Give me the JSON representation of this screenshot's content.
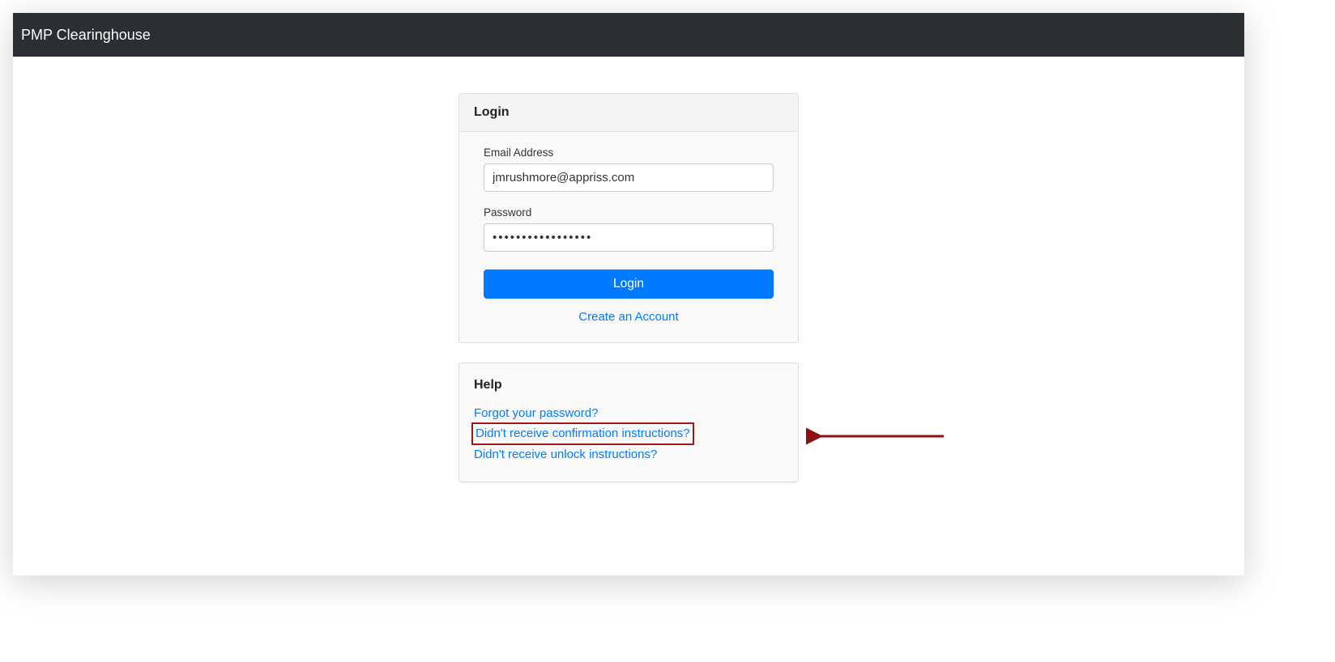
{
  "navbar": {
    "title": "PMP Clearinghouse"
  },
  "login_card": {
    "header": "Login",
    "email_label": "Email Address",
    "email_value": "jmrushmore@appriss.com",
    "password_label": "Password",
    "password_value": "•••••••••••••••••",
    "login_button": "Login",
    "create_account": "Create an Account"
  },
  "help_card": {
    "header": "Help",
    "links": {
      "forgot_password": "Forgot your password?",
      "confirmation": "Didn't receive confirmation instructions?",
      "unlock": "Didn't receive unlock instructions?"
    }
  }
}
